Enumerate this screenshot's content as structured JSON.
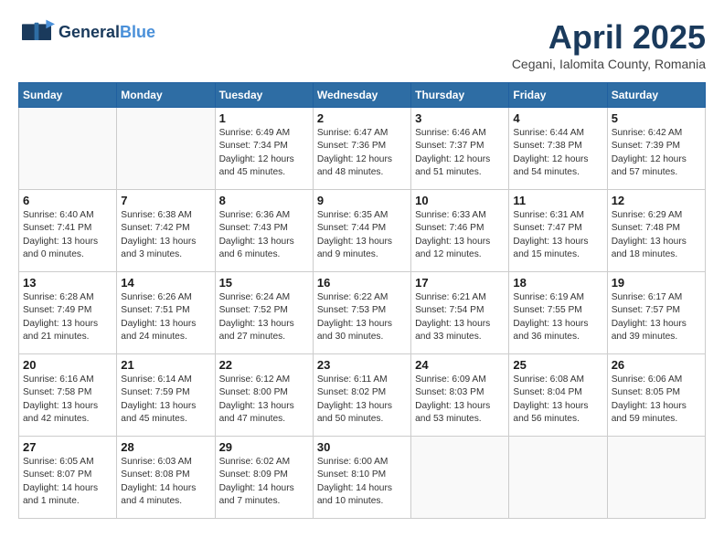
{
  "header": {
    "logo_general": "General",
    "logo_blue": "Blue",
    "month_title": "April 2025",
    "subtitle": "Cegani, Ialomita County, Romania"
  },
  "weekdays": [
    "Sunday",
    "Monday",
    "Tuesday",
    "Wednesday",
    "Thursday",
    "Friday",
    "Saturday"
  ],
  "weeks": [
    [
      {
        "day": "",
        "detail": ""
      },
      {
        "day": "",
        "detail": ""
      },
      {
        "day": "1",
        "detail": "Sunrise: 6:49 AM\nSunset: 7:34 PM\nDaylight: 12 hours\nand 45 minutes."
      },
      {
        "day": "2",
        "detail": "Sunrise: 6:47 AM\nSunset: 7:36 PM\nDaylight: 12 hours\nand 48 minutes."
      },
      {
        "day": "3",
        "detail": "Sunrise: 6:46 AM\nSunset: 7:37 PM\nDaylight: 12 hours\nand 51 minutes."
      },
      {
        "day": "4",
        "detail": "Sunrise: 6:44 AM\nSunset: 7:38 PM\nDaylight: 12 hours\nand 54 minutes."
      },
      {
        "day": "5",
        "detail": "Sunrise: 6:42 AM\nSunset: 7:39 PM\nDaylight: 12 hours\nand 57 minutes."
      }
    ],
    [
      {
        "day": "6",
        "detail": "Sunrise: 6:40 AM\nSunset: 7:41 PM\nDaylight: 13 hours\nand 0 minutes."
      },
      {
        "day": "7",
        "detail": "Sunrise: 6:38 AM\nSunset: 7:42 PM\nDaylight: 13 hours\nand 3 minutes."
      },
      {
        "day": "8",
        "detail": "Sunrise: 6:36 AM\nSunset: 7:43 PM\nDaylight: 13 hours\nand 6 minutes."
      },
      {
        "day": "9",
        "detail": "Sunrise: 6:35 AM\nSunset: 7:44 PM\nDaylight: 13 hours\nand 9 minutes."
      },
      {
        "day": "10",
        "detail": "Sunrise: 6:33 AM\nSunset: 7:46 PM\nDaylight: 13 hours\nand 12 minutes."
      },
      {
        "day": "11",
        "detail": "Sunrise: 6:31 AM\nSunset: 7:47 PM\nDaylight: 13 hours\nand 15 minutes."
      },
      {
        "day": "12",
        "detail": "Sunrise: 6:29 AM\nSunset: 7:48 PM\nDaylight: 13 hours\nand 18 minutes."
      }
    ],
    [
      {
        "day": "13",
        "detail": "Sunrise: 6:28 AM\nSunset: 7:49 PM\nDaylight: 13 hours\nand 21 minutes."
      },
      {
        "day": "14",
        "detail": "Sunrise: 6:26 AM\nSunset: 7:51 PM\nDaylight: 13 hours\nand 24 minutes."
      },
      {
        "day": "15",
        "detail": "Sunrise: 6:24 AM\nSunset: 7:52 PM\nDaylight: 13 hours\nand 27 minutes."
      },
      {
        "day": "16",
        "detail": "Sunrise: 6:22 AM\nSunset: 7:53 PM\nDaylight: 13 hours\nand 30 minutes."
      },
      {
        "day": "17",
        "detail": "Sunrise: 6:21 AM\nSunset: 7:54 PM\nDaylight: 13 hours\nand 33 minutes."
      },
      {
        "day": "18",
        "detail": "Sunrise: 6:19 AM\nSunset: 7:55 PM\nDaylight: 13 hours\nand 36 minutes."
      },
      {
        "day": "19",
        "detail": "Sunrise: 6:17 AM\nSunset: 7:57 PM\nDaylight: 13 hours\nand 39 minutes."
      }
    ],
    [
      {
        "day": "20",
        "detail": "Sunrise: 6:16 AM\nSunset: 7:58 PM\nDaylight: 13 hours\nand 42 minutes."
      },
      {
        "day": "21",
        "detail": "Sunrise: 6:14 AM\nSunset: 7:59 PM\nDaylight: 13 hours\nand 45 minutes."
      },
      {
        "day": "22",
        "detail": "Sunrise: 6:12 AM\nSunset: 8:00 PM\nDaylight: 13 hours\nand 47 minutes."
      },
      {
        "day": "23",
        "detail": "Sunrise: 6:11 AM\nSunset: 8:02 PM\nDaylight: 13 hours\nand 50 minutes."
      },
      {
        "day": "24",
        "detail": "Sunrise: 6:09 AM\nSunset: 8:03 PM\nDaylight: 13 hours\nand 53 minutes."
      },
      {
        "day": "25",
        "detail": "Sunrise: 6:08 AM\nSunset: 8:04 PM\nDaylight: 13 hours\nand 56 minutes."
      },
      {
        "day": "26",
        "detail": "Sunrise: 6:06 AM\nSunset: 8:05 PM\nDaylight: 13 hours\nand 59 minutes."
      }
    ],
    [
      {
        "day": "27",
        "detail": "Sunrise: 6:05 AM\nSunset: 8:07 PM\nDaylight: 14 hours\nand 1 minute."
      },
      {
        "day": "28",
        "detail": "Sunrise: 6:03 AM\nSunset: 8:08 PM\nDaylight: 14 hours\nand 4 minutes."
      },
      {
        "day": "29",
        "detail": "Sunrise: 6:02 AM\nSunset: 8:09 PM\nDaylight: 14 hours\nand 7 minutes."
      },
      {
        "day": "30",
        "detail": "Sunrise: 6:00 AM\nSunset: 8:10 PM\nDaylight: 14 hours\nand 10 minutes."
      },
      {
        "day": "",
        "detail": ""
      },
      {
        "day": "",
        "detail": ""
      },
      {
        "day": "",
        "detail": ""
      }
    ]
  ]
}
